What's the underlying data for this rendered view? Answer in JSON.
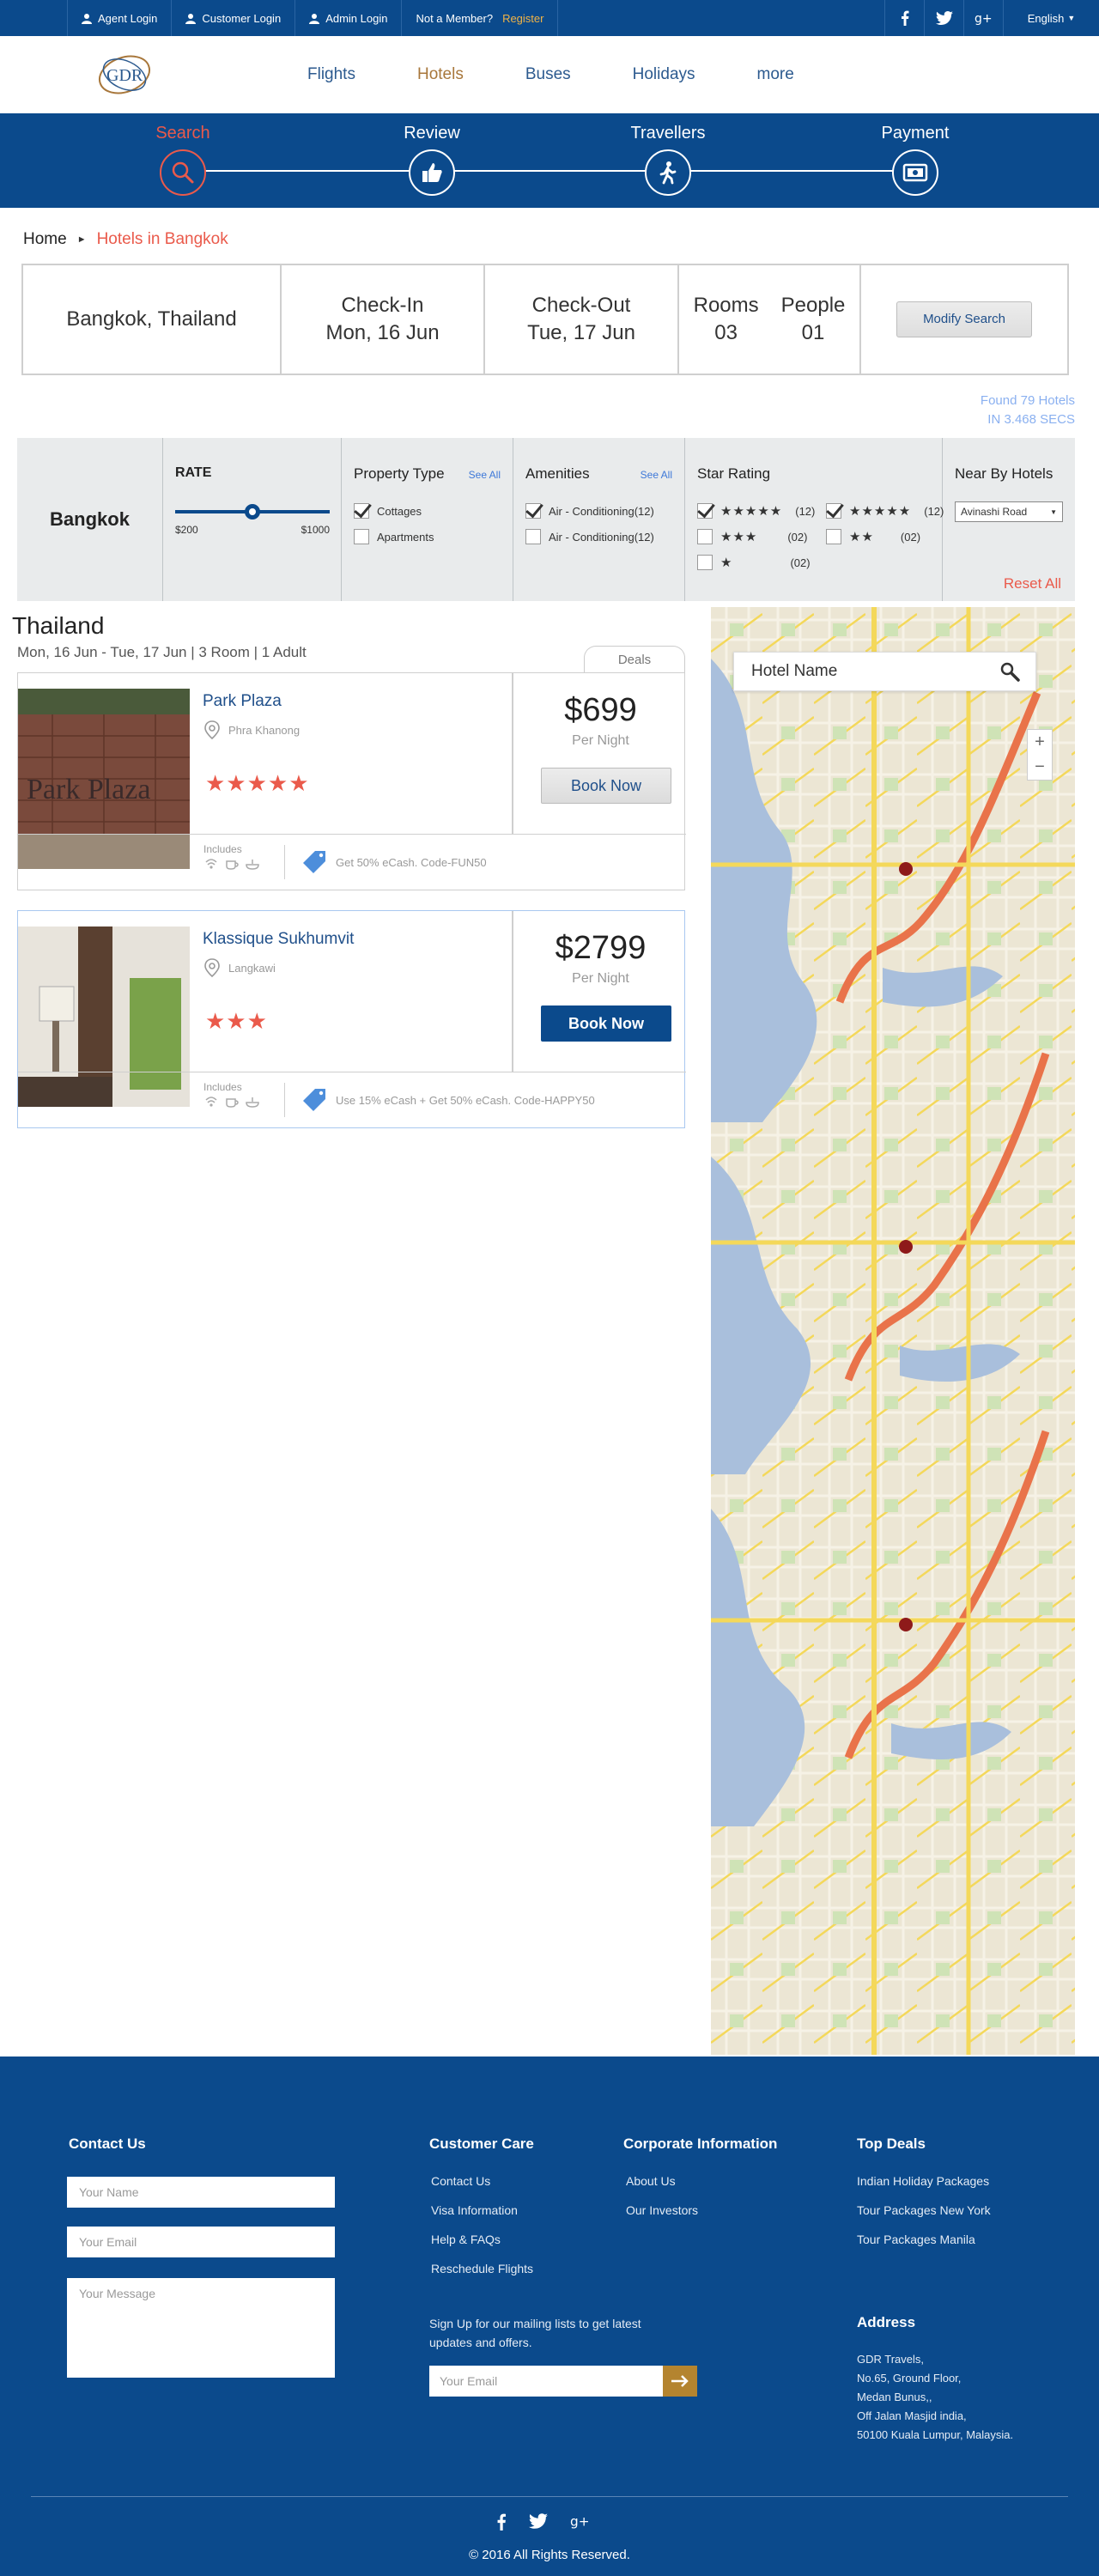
{
  "topbar": {
    "agent_login": "Agent Login",
    "customer_login": "Customer Login",
    "admin_login": "Admin Login",
    "not_member": "Not a Member?",
    "register": "Register",
    "language": "English",
    "social": [
      "facebook-icon",
      "twitter-icon",
      "google-plus-icon"
    ]
  },
  "logo": {
    "text": "GDR"
  },
  "nav": {
    "flights": "Flights",
    "hotels": "Hotels",
    "buses": "Buses",
    "holidays": "Holidays",
    "more": "more"
  },
  "steps": {
    "search": "Search",
    "review": "Review",
    "travellers": "Travellers",
    "payment": "Payment"
  },
  "breadcrumb": {
    "home": "Home",
    "current": "Hotels in Bangkok"
  },
  "search": {
    "destination": "Bangkok, Thailand",
    "checkin_label": "Check-In",
    "checkin_date": "Mon, 16 Jun",
    "checkout_label": "Check-Out",
    "checkout_date": "Tue, 17 Jun",
    "rooms_label": "Rooms",
    "rooms_value": "03",
    "people_label": "People",
    "people_value": "01",
    "modify_button": "Modify Search"
  },
  "found": {
    "line1": "Found 79 Hotels",
    "line2": "IN 3.468 SECS"
  },
  "filters": {
    "city": "Bangkok",
    "rate": {
      "title": "RATE",
      "min_label": "$200",
      "max_label": "$1000",
      "selected_fraction": 0.5
    },
    "property": {
      "title": "Property Type",
      "see_all": "See All",
      "options": [
        {
          "label": "Cottages",
          "checked": true
        },
        {
          "label": "Apartments",
          "checked": false
        }
      ]
    },
    "amenities": {
      "title": "Amenities",
      "see_all": "See All",
      "options": [
        {
          "label": "Air - Conditioning(12)",
          "checked": true
        },
        {
          "label": "Air - Conditioning(12)",
          "checked": false
        }
      ]
    },
    "stars": {
      "title": "Star Rating",
      "rows": [
        {
          "stars": "★★★★★",
          "count": "(12)",
          "checked": true
        },
        {
          "stars": "★★★★★",
          "count": "(12)",
          "checked": true
        },
        {
          "stars": "★★★",
          "count": "(02)",
          "checked": false
        },
        {
          "stars": "★★",
          "count": "(02)",
          "checked": false
        },
        {
          "stars": "★",
          "count": "(02)",
          "checked": false
        }
      ]
    },
    "near_by": {
      "title": "Near By Hotels",
      "selected": "Avinashi Road"
    },
    "reset": "Reset All"
  },
  "results": {
    "title": "Thailand",
    "subtitle": "Mon, 16 Jun - Tue, 17 Jun | 3 Room | 1 Adult",
    "deals_tab": "Deals",
    "hotels": [
      {
        "name": "Park Plaza",
        "location": "Phra Khanong",
        "rating": "★★★★★",
        "price": "$699",
        "per": "Per Night",
        "book": "Book Now",
        "includes": "Includes",
        "offer": "Get 50% eCash. Code-FUN50",
        "image_text": "Park Plaza"
      },
      {
        "name": "Klassique Sukhumvit",
        "location": "Langkawi",
        "rating": "★★★",
        "price": "$2799",
        "per": "Per Night",
        "book": "Book Now",
        "includes": "Includes",
        "offer": "Use 15% eCash + Get 50% eCash. Code-HAPPY50"
      }
    ]
  },
  "map": {
    "search_placeholder": "Hotel Name",
    "zoom_in": "+",
    "zoom_out": "−"
  },
  "footer": {
    "contact": {
      "title": "Contact Us",
      "name_ph": "Your Name",
      "email_ph": "Your Email",
      "message_ph": "Your Message"
    },
    "care": {
      "title": "Customer Care",
      "links": [
        "Contact Us",
        "Visa Information",
        "Help & FAQs",
        "Reschedule Flights"
      ]
    },
    "corporate": {
      "title": "Corporate Information",
      "links": [
        "About Us",
        "Our Investors"
      ]
    },
    "deals": {
      "title": "Top Deals",
      "links": [
        "Indian Holiday Packages",
        "Tour Packages New York",
        "Tour Packages Manila"
      ]
    },
    "signup_text_1": "Sign Up for our mailing lists to get latest",
    "signup_text_2": "updates and offers.",
    "signup_ph": "Your Email",
    "address": {
      "title": "Address",
      "lines": [
        "GDR Travels,",
        "No.65, Ground Floor,",
        "Medan Bunus,,",
        "Off Jalan Masjid india,",
        "50100 Kuala Lumpur, Malaysia."
      ]
    },
    "copyright": "© 2016 All Rights Reserved."
  },
  "colors": {
    "brand_blue": "#0b4a8c",
    "accent_red": "#ea5a4b",
    "accent_gold": "#a8773b"
  }
}
